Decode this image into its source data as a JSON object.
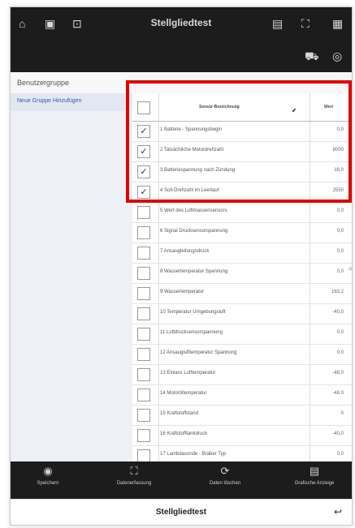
{
  "app": {
    "title": "Stellgliedtest"
  },
  "topbar": {
    "left_icons": [
      "home-icon",
      "phone-icon",
      "car-edit-icon"
    ],
    "right_icons": [
      "document-icon",
      "expand-icon",
      "grid-icon"
    ],
    "second_row_icons": [
      "car-icon",
      "steering-wheel-icon"
    ]
  },
  "sidebar": {
    "header_label": "Benutzergruppe",
    "items": [
      {
        "label": "Neue Gruppe Hinzufügen"
      }
    ]
  },
  "table": {
    "columns": [
      "Sensor-Bezeichnung",
      "Wert"
    ],
    "rows": [
      {
        "label": "1 Batterie - Spannungsbegin",
        "value": "0,0",
        "checked": true
      },
      {
        "label": "2 Tatsächliche Motordrehzahl",
        "value": "8000",
        "checked": true
      },
      {
        "label": "3 Batteriespannung nach Zündung",
        "value": "16,0",
        "checked": true
      },
      {
        "label": "4 Soll-Drehzahl im Leerlauf",
        "value": "2550",
        "checked": true
      },
      {
        "label": "5 Wert des Luftmassensensors",
        "value": "0,0",
        "checked": false
      },
      {
        "label": "6 Signal Drucksensorspannung",
        "value": "0,0",
        "checked": false
      },
      {
        "label": "7 Ansaugleitungsdruck",
        "value": "0,0",
        "checked": false
      },
      {
        "label": "8 Wassertemperatur Spannung",
        "value": "0,0",
        "checked": false
      },
      {
        "label": "9 Wassertemperatur",
        "value": "163,2",
        "checked": false
      },
      {
        "label": "10 Temperatur Umgebungsluft",
        "value": "-40,0",
        "checked": false
      },
      {
        "label": "11 Luftdrucksensorspannung",
        "value": "0,0",
        "checked": false
      },
      {
        "label": "12 Ansauglufttemperatur Spannung",
        "value": "0,0",
        "checked": false
      },
      {
        "label": "13 Einlass Lufttemperatur",
        "value": "-48,0",
        "checked": false
      },
      {
        "label": "14 Motoröltemperatur",
        "value": "-48,0",
        "checked": false
      },
      {
        "label": "15 Kraftstoffstand",
        "value": "0",
        "checked": false
      },
      {
        "label": "16 Kraftstofftankdruck",
        "value": "-40,0",
        "checked": false
      },
      {
        "label": "17 Lambdasonde - Bräber Typ",
        "value": "0,0",
        "checked": false
      }
    ]
  },
  "bottom_bar": {
    "items": [
      {
        "label": "Speichern",
        "icon": "save-icon"
      },
      {
        "label": "Datenerfassung",
        "icon": "capture-icon"
      },
      {
        "label": "Daten löschen",
        "icon": "refresh-icon"
      },
      {
        "label": "Grafische Anzeige",
        "icon": "chart-icon"
      }
    ]
  },
  "footer": {
    "title": "Stellgliedtest",
    "back_icon": "back-icon"
  },
  "colors": {
    "bar": "#1c1c1c",
    "highlight": "#e00000",
    "sidebar_bg": "#eef0f5",
    "link": "#3355aa"
  }
}
